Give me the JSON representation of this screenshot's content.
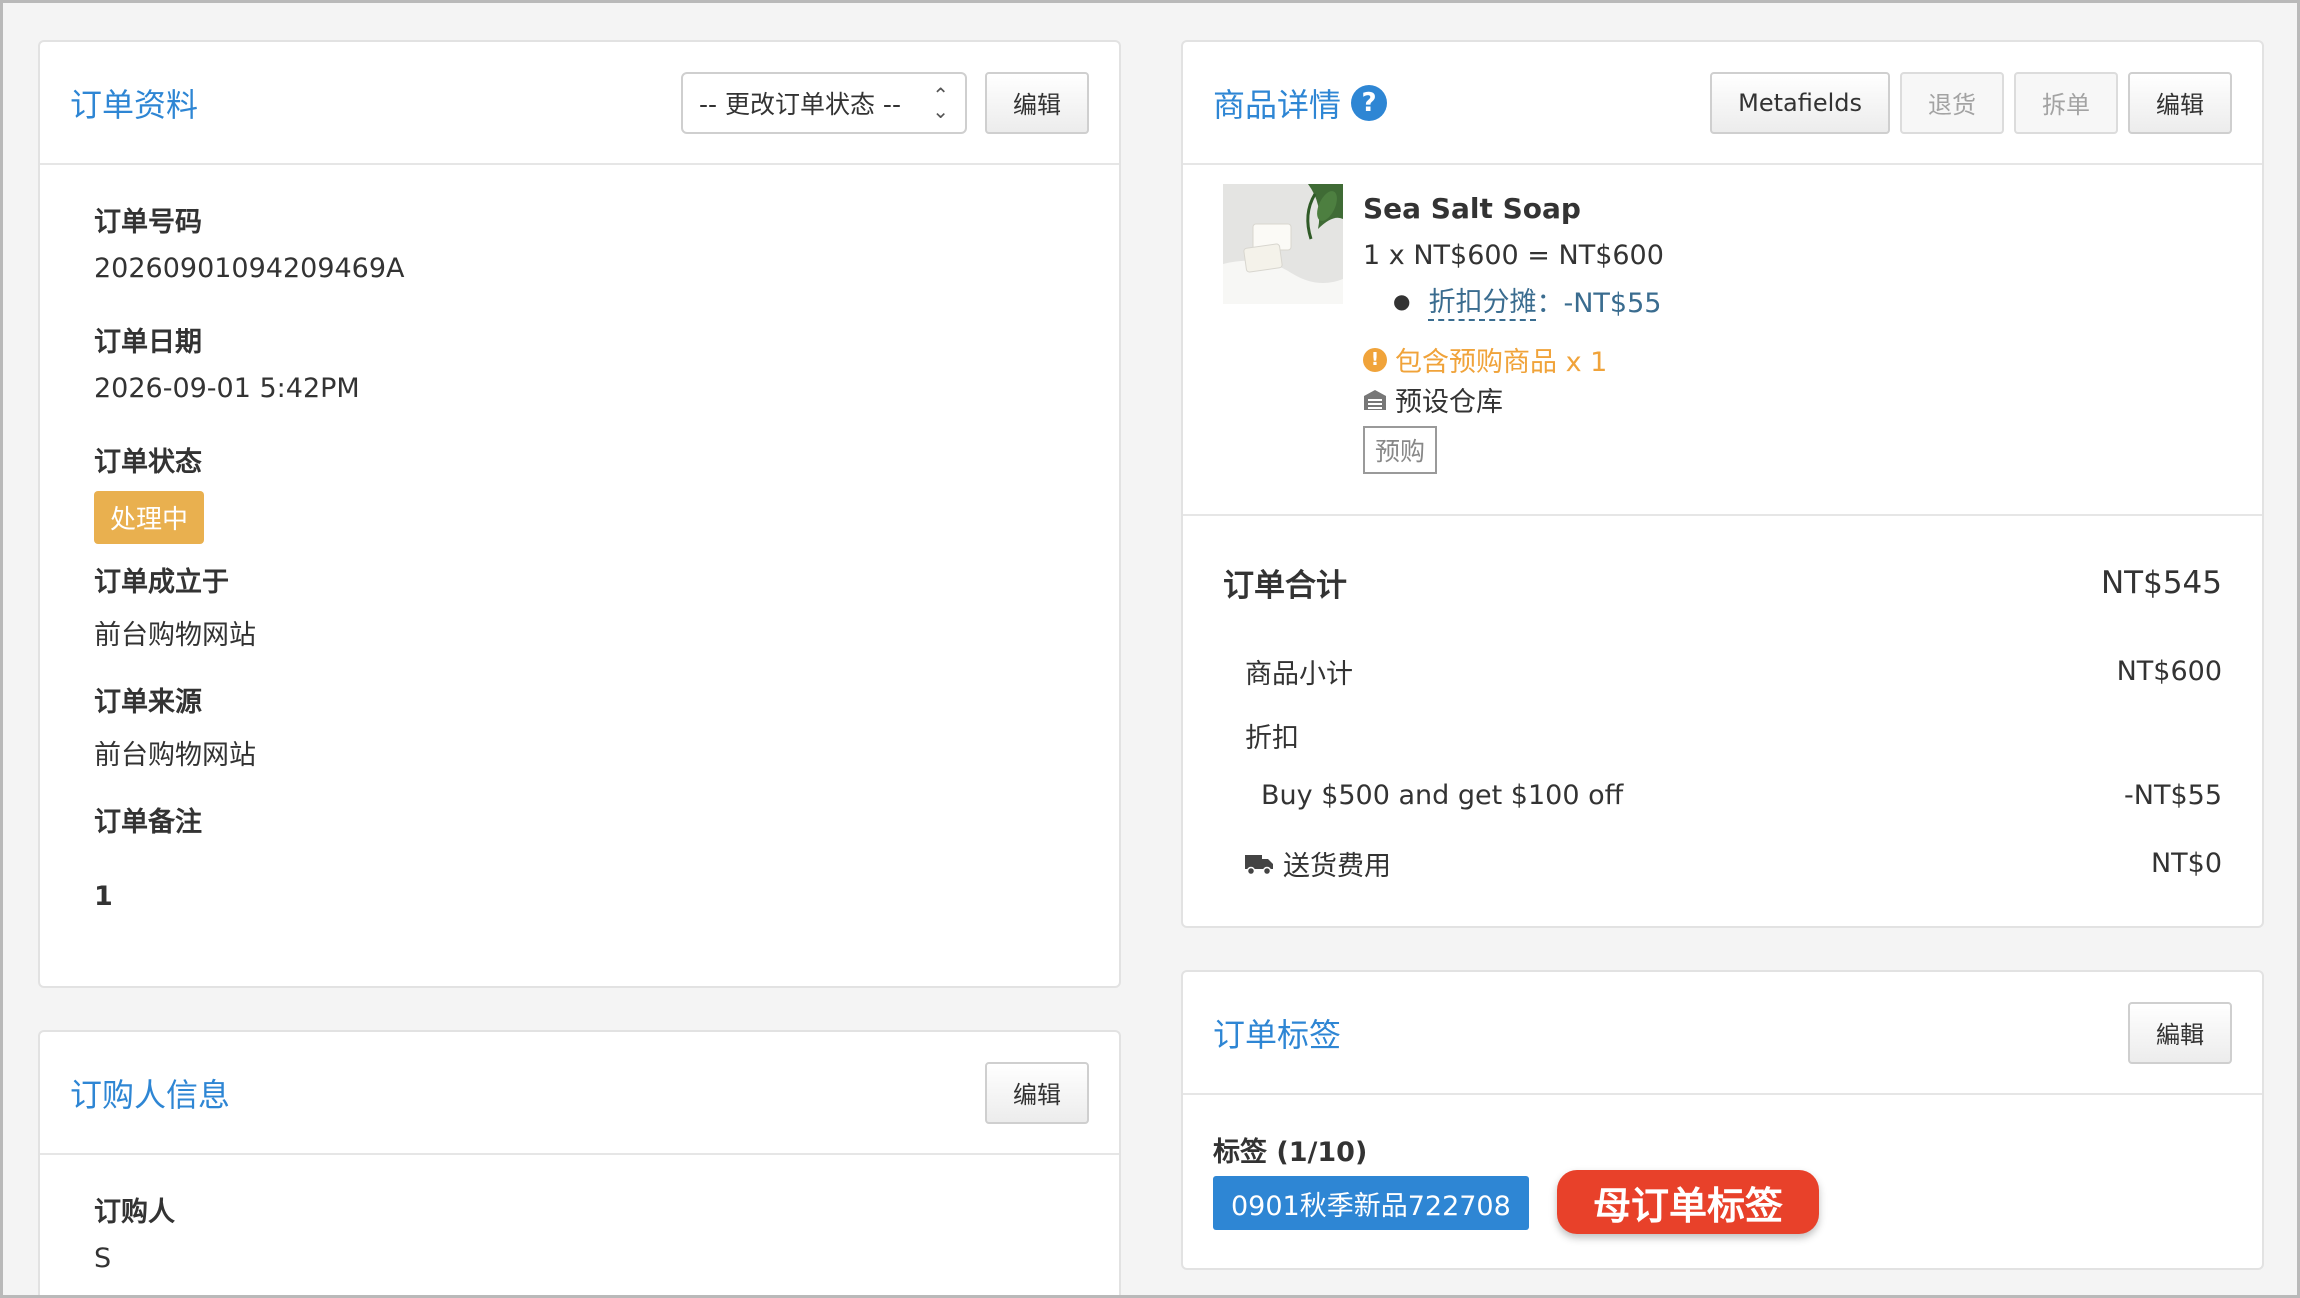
{
  "order_info": {
    "title": "订单资料",
    "status_select": "-- 更改订单状态 --",
    "edit_label": "编辑",
    "fields": {
      "order_number_label": "订单号码",
      "order_number": "20260901094209469A",
      "order_date_label": "订单日期",
      "order_date": "2026-09-01 5:42PM",
      "order_status_label": "订单状态",
      "order_status": "处理中",
      "created_at_label": "订单成立于",
      "created_at": "前台购物网站",
      "source_label": "订单来源",
      "source": "前台购物网站",
      "notes_label": "订单备注",
      "notes": "1"
    }
  },
  "buyer_info": {
    "title": "订购人信息",
    "edit_label": "编辑",
    "buyer_label": "订购人",
    "buyer": "S"
  },
  "product_details": {
    "title": "商品详情",
    "help_icon": "?",
    "buttons": {
      "metafields": "Metafields",
      "return": "退货",
      "split": "拆单",
      "edit": "编辑"
    },
    "item": {
      "name": "Sea Salt Soap",
      "price_line": "1 x NT$600 = NT$600",
      "discount_link": "折扣分摊",
      "discount_value": "：-NT$55",
      "preorder_warning": "包含预购商品 x 1",
      "warehouse": "预设仓库",
      "preorder_tag": "预购"
    },
    "totals": {
      "order_total_label": "订单合计",
      "order_total": "NT$545",
      "subtotal_label": "商品小计",
      "subtotal": "NT$600",
      "discount_label": "折扣",
      "promo_label": "Buy $500 and get $100 off",
      "promo_value": "-NT$55",
      "shipping_label": "送货费用",
      "shipping": "NT$0"
    }
  },
  "order_tags": {
    "title": "订单标签",
    "edit_label": "編輯",
    "tags_label": "标签 (1/10)",
    "tag": "0901秋季新品722708",
    "parent_tag": "母订单标签"
  },
  "colors": {
    "accent": "#2e86d4",
    "status_processing": "#e9b04f",
    "warning": "#f0a33a",
    "parent_tag": "#e8412a"
  }
}
